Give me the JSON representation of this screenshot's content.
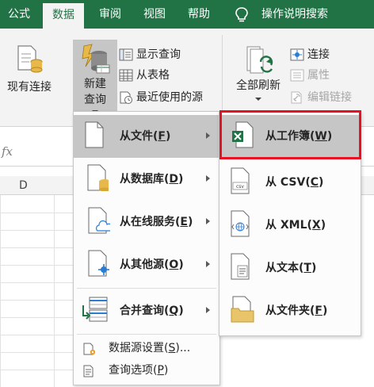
{
  "tabs": [
    {
      "label": "公式",
      "active": false
    },
    {
      "label": "数据",
      "active": true
    },
    {
      "label": "审阅",
      "active": false
    },
    {
      "label": "视图",
      "active": false
    },
    {
      "label": "帮助",
      "active": false
    }
  ],
  "tell_me": {
    "label": "操作说明搜索",
    "icon": "lightbulb-icon"
  },
  "ribbon": {
    "existing_connections": "现有连接",
    "new_query_line1": "新建",
    "new_query_line2": "查询",
    "show_queries": "显示查询",
    "from_table": "从表格",
    "recent_sources": "最近使用的源",
    "refresh_all_line1": "全部刷新",
    "connections": "连接",
    "properties": "属性",
    "edit_links": "编辑链接"
  },
  "sheet": {
    "fx_label": "fx",
    "column_header": "D"
  },
  "new_query_menu": {
    "items": [
      {
        "label": "从文件(F)",
        "text": "从文件(",
        "key": "F",
        "tail": ")",
        "icon": "document-icon",
        "highlighted": true
      },
      {
        "label": "从数据库(D)",
        "text": "从数据库(",
        "key": "D",
        "tail": ")",
        "icon": "database-icon",
        "highlighted": false
      },
      {
        "label": "从在线服务(E)",
        "text": "从在线服务(",
        "key": "E",
        "tail": ")",
        "icon": "cloud-icon",
        "highlighted": false
      },
      {
        "label": "从其他源(O)",
        "text": "从其他源(",
        "key": "O",
        "tail": ")",
        "icon": "other-source-icon",
        "highlighted": false
      },
      {
        "label": "合并查询(Q)",
        "text": "合并查询(",
        "key": "Q",
        "tail": ")",
        "icon": "merge-icon",
        "highlighted": false
      }
    ],
    "data_source_settings": {
      "text": "数据源设置(",
      "key": "S",
      "tail": ")..."
    },
    "query_options": {
      "text": "查询选项(",
      "key": "P",
      "tail": ")"
    }
  },
  "from_file_submenu": {
    "items": [
      {
        "text": "从工作簿(",
        "key": "W",
        "tail": ")",
        "icon": "excel-workbook-icon",
        "highlighted": true
      },
      {
        "text": "从 CSV(",
        "key": "C",
        "tail": ")",
        "icon": "csv-file-icon",
        "highlighted": false
      },
      {
        "text": "从 XML(",
        "key": "X",
        "tail": ")",
        "icon": "xml-file-icon",
        "highlighted": false
      },
      {
        "text": "从文本(",
        "key": "T",
        "tail": ")",
        "icon": "text-file-icon",
        "highlighted": false
      },
      {
        "text": "从文件夹(",
        "key": "F",
        "tail": ")",
        "icon": "folder-icon",
        "highlighted": false
      }
    ]
  },
  "colors": {
    "excel_green": "#217346",
    "highlight": "#c6c6c6",
    "callout_red": "#e81123"
  }
}
